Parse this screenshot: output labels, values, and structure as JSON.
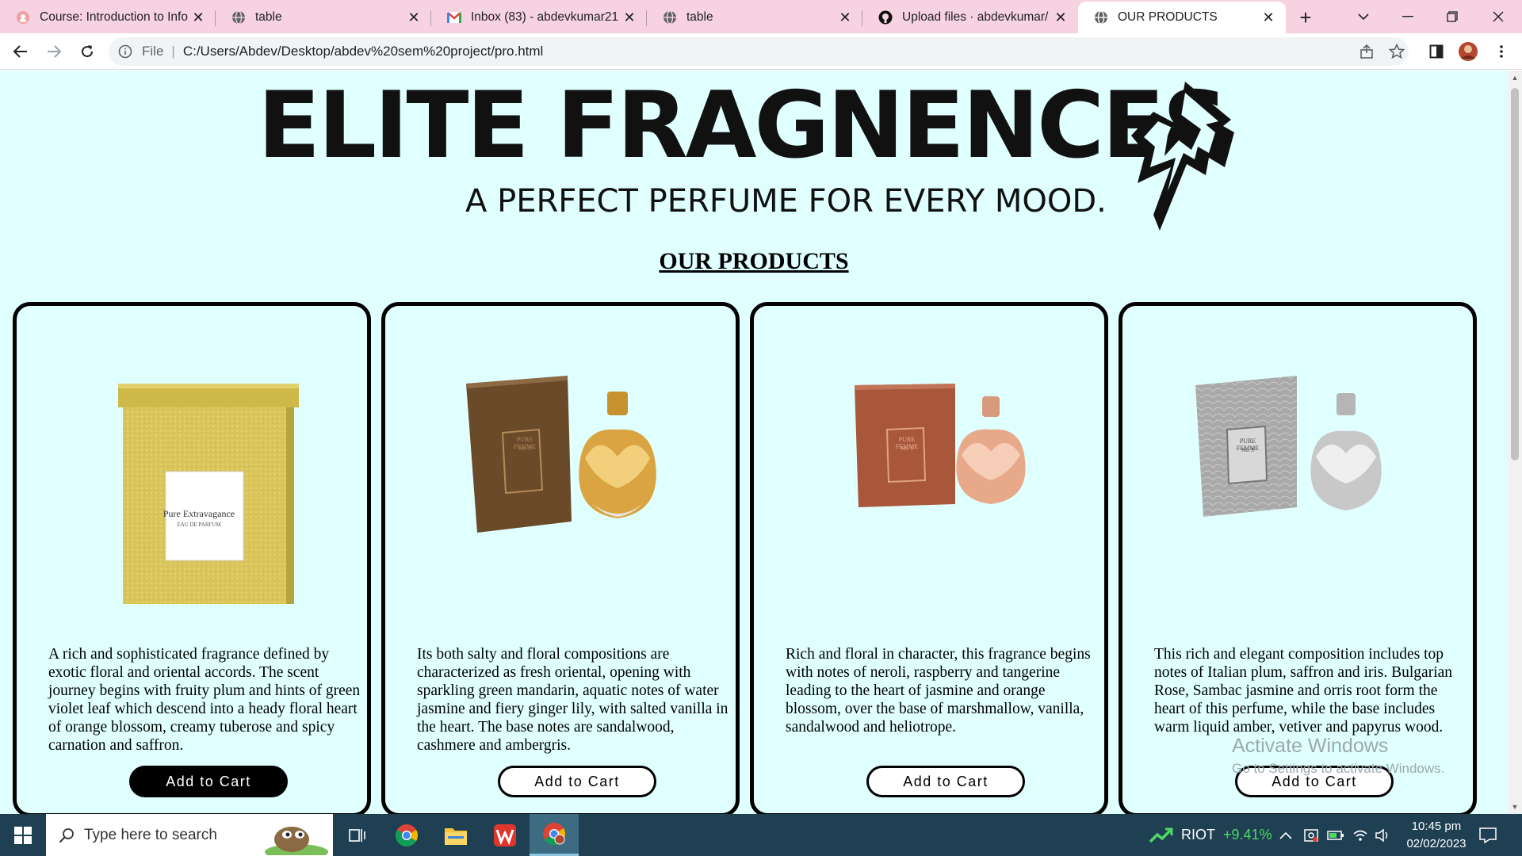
{
  "browser": {
    "tabs": [
      {
        "title": "Course: Introduction to Info",
        "favicon": "moodle-icon",
        "active": false
      },
      {
        "title": "table",
        "favicon": "globe-icon",
        "active": false
      },
      {
        "title": "Inbox (83) - abdevkumar21",
        "favicon": "gmail-icon",
        "active": false
      },
      {
        "title": "table",
        "favicon": "globe-icon",
        "active": false
      },
      {
        "title": "Upload files · abdevkumar/",
        "favicon": "github-icon",
        "active": false
      },
      {
        "title": "OUR PRODUCTS",
        "favicon": "globe-icon",
        "active": true
      }
    ],
    "address": {
      "scheme": "File",
      "url": "C:/Users/Abdev/Desktop/abdev%20sem%20project/pro.html"
    }
  },
  "page": {
    "brand": "ELITE FRAGNENCES",
    "tagline": "A PERFECT PERFUME FOR EVERY MOOD.",
    "heading": "OUR PRODUCTS",
    "products": [
      {
        "box_label": "Pure Extravagance",
        "box_sublabel": "EAU DE PARFUM",
        "description": "A rich and sophisticated fragrance defined by exotic floral and oriental accords. The scent journey begins with fruity plum and hints of green violet leaf which descend into a heady floral heart of orange blossom, creamy tuberose and spicy carnation and saffron.",
        "button": "Add to Cart",
        "box_color": "#d9c55a",
        "bottle_color": null
      },
      {
        "box_label": "PURE FEMME",
        "box_sublabel": "No. 2",
        "description": "Its both salty and floral compositions are characterized as fresh oriental, opening with sparkling green mandarin, aquatic notes of water jasmine and fiery ginger lily, with salted vanilla in the heart. The base notes are sandalwood, cashmere and ambergris.",
        "button": "Add to Cart",
        "box_color": "#6b4a2a",
        "bottle_color": "#d9a441"
      },
      {
        "box_label": "PURE FEMME",
        "box_sublabel": "No. 1",
        "description": "Rich and floral in character, this fragrance begins with notes of neroli, raspberry and tangerine leading to the heart of jasmine and orange blossom, over the base of marshmallow, vanilla, sandalwood and heliotrope.",
        "button": "Add to Cart",
        "box_color": "#a8573a",
        "bottle_color": "#e8a98a"
      },
      {
        "box_label": "PURE FEMME",
        "box_sublabel": "No. 3",
        "description": "This rich and elegant composition includes top notes of Italian plum, saffron and iris. Bulgarian Rose, Sambac jasmine and orris root form the heart of this perfume, while the base includes warm liquid amber, vetiver and papyrus wood.",
        "button": "Add to Cart",
        "box_color": "#a9a9a9",
        "bottle_color": "#c8c8c8"
      }
    ],
    "watermark": {
      "line1": "Activate Windows",
      "line2": "Go to Settings to activate Windows."
    }
  },
  "taskbar": {
    "search_placeholder": "Type here to search",
    "stock_name": "RIOT",
    "stock_change": "+9.41%",
    "time": "10:45 pm",
    "date": "02/02/2023"
  },
  "colors": {
    "page_bg": "#e0ffff",
    "tab_strip": "#f7d2e0",
    "taskbar": "#1f3f52",
    "stock_up": "#4cd964"
  }
}
